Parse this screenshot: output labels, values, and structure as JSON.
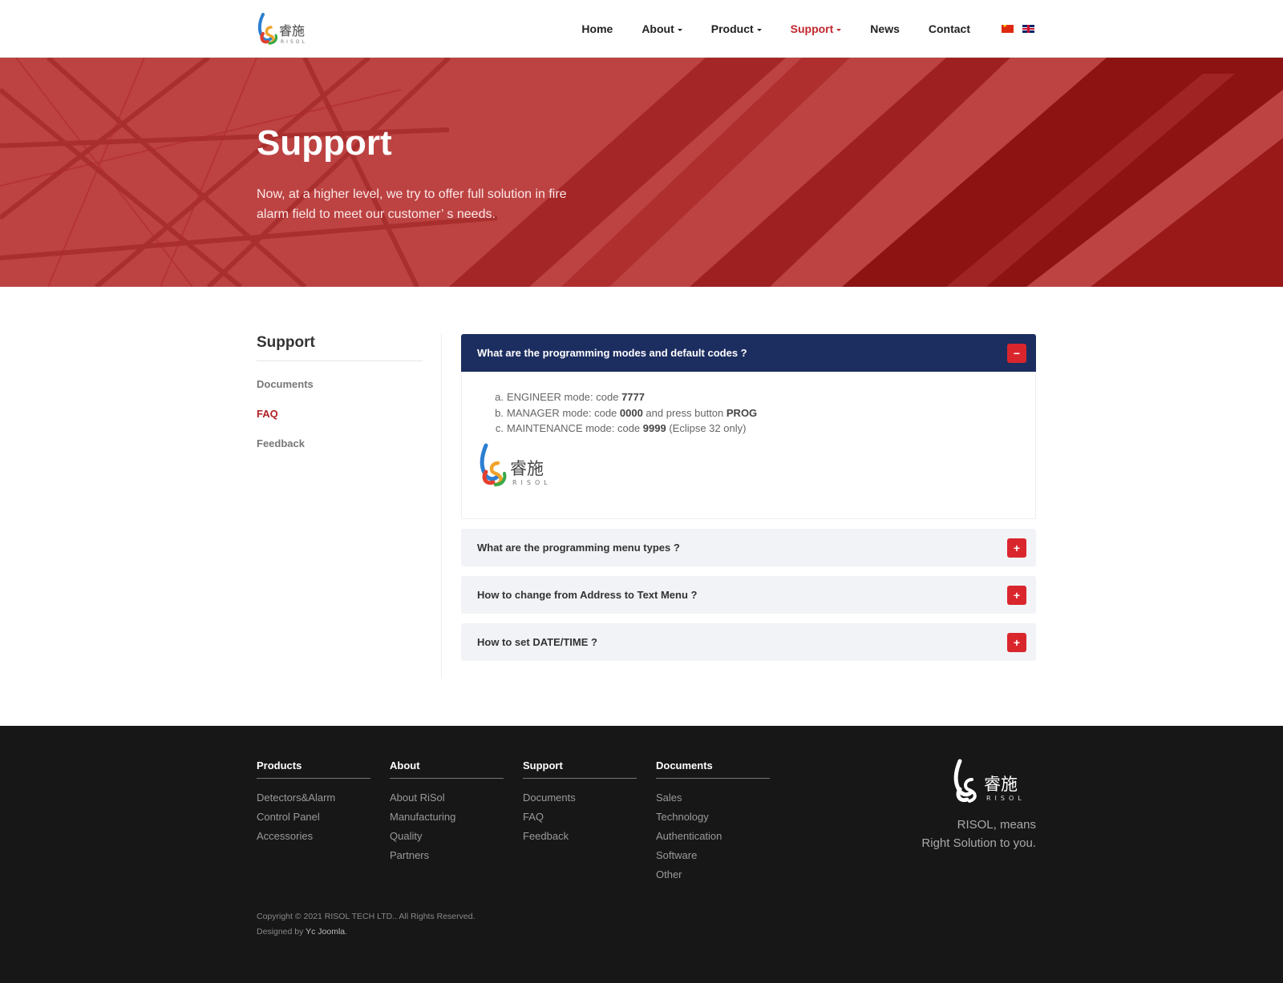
{
  "header": {
    "logo_text": "睿施",
    "logo_sub": "RISOL",
    "nav": [
      {
        "label": "Home",
        "has_caret": false,
        "active": false
      },
      {
        "label": "About",
        "has_caret": true,
        "active": false
      },
      {
        "label": "Product",
        "has_caret": true,
        "active": false
      },
      {
        "label": "Support",
        "has_caret": true,
        "active": true
      },
      {
        "label": "News",
        "has_caret": false,
        "active": false
      },
      {
        "label": "Contact",
        "has_caret": false,
        "active": false
      }
    ],
    "languages": [
      "cn-flag-icon",
      "uk-flag-icon"
    ]
  },
  "hero": {
    "title": "Support",
    "subtitle": "Now, at a higher level, we try to offer full solution in fire alarm field to meet our customer’ s needs."
  },
  "sidebar": {
    "title": "Support",
    "items": [
      {
        "label": "Documents"
      },
      {
        "label": "FAQ"
      },
      {
        "label": "Feedback"
      }
    ]
  },
  "faq": {
    "open": {
      "question": "What are the programming modes and default codes ?",
      "toggle": "−",
      "codes": [
        {
          "marker": "a.",
          "pre": "ENGINEER mode: code ",
          "code": "7777",
          "mid": "",
          "btn": "",
          "post": ""
        },
        {
          "marker": "b.",
          "pre": "MANAGER mode: code ",
          "code": "0000",
          "mid": " and press button ",
          "btn": "PROG",
          "post": ""
        },
        {
          "marker": "c.",
          "pre": "MAINTENANCE mode: code ",
          "code": "9999",
          "mid": "",
          "btn": "",
          "post": " (Eclipse 32 only)"
        }
      ]
    },
    "closed": [
      {
        "question": "What are the programming menu types ?",
        "toggle": "+"
      },
      {
        "question": "How to change from Address to Text Menu ?",
        "toggle": "+"
      },
      {
        "question": "How to set DATE/TIME ?",
        "toggle": "+"
      }
    ]
  },
  "footer": {
    "columns": [
      {
        "title": "Products",
        "links": [
          "Detectors&Alarm",
          "Control Panel",
          "Accessories"
        ]
      },
      {
        "title": "About",
        "links": [
          "About RiSol",
          "Manufacturing",
          "Quality",
          "Partners"
        ]
      },
      {
        "title": "Support",
        "links": [
          "Documents",
          "FAQ",
          "Feedback"
        ]
      },
      {
        "title": "Documents",
        "links": [
          "Sales",
          "Technology",
          "Authentication",
          "Software",
          "Other"
        ]
      }
    ],
    "tagline_1": "RISOL, means",
    "tagline_2": "Right Solution to you.",
    "copyright": "Copyright © 2021 RISOL TECH LTD.. All Rights Reserved.",
    "designed_prefix": "Designed by ",
    "designer": "Yc Joomla",
    "designed_suffix": "."
  },
  "colors": {
    "accent": "#c0272d",
    "hero_red": "#bb3b3b",
    "accordion_head": "#1c2e60",
    "footer_bg": "#171717"
  }
}
